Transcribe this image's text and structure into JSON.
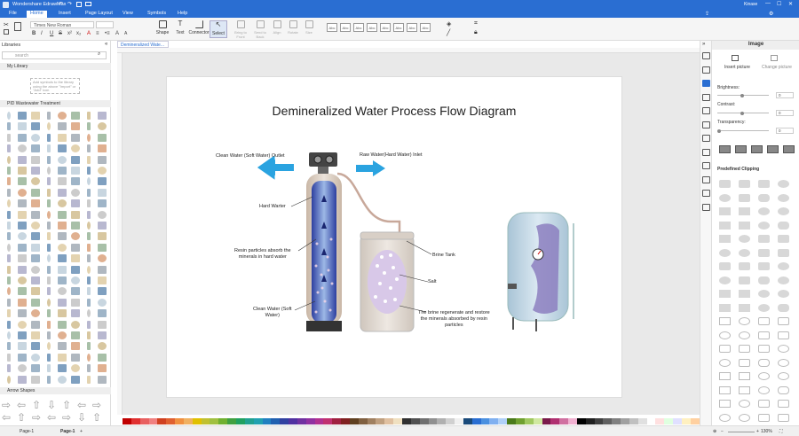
{
  "app": {
    "title": "Wondershare EdrawMax",
    "window_controls": [
      "—",
      "☐",
      "✕"
    ],
    "user": "Kinase"
  },
  "menu": {
    "items": [
      "File",
      "Home",
      "Insert",
      "Page Layout",
      "View",
      "Symbols",
      "Help"
    ],
    "active": "Home"
  },
  "ribbon": {
    "font": "Times New Roman",
    "size": "",
    "format": [
      "B",
      "I",
      "U",
      "S",
      "x²",
      "x₂",
      "A",
      "≡",
      "•≡",
      "A",
      "A"
    ],
    "tools": [
      {
        "label": "Shape"
      },
      {
        "label": "Text"
      },
      {
        "label": "Connector"
      },
      {
        "label": "Select"
      },
      {
        "label": "Bring to Front"
      },
      {
        "label": "Send to Back"
      },
      {
        "label": "Align"
      },
      {
        "label": "Rotate"
      },
      {
        "label": "Size"
      }
    ],
    "styles": [
      "Abc",
      "Abc",
      "Abc",
      "Abc",
      "Abc",
      "Abc",
      "Abc",
      "Abc"
    ]
  },
  "sidebar": {
    "title": "Libraries",
    "search_placeholder": "search",
    "my_library": "My Library",
    "hint": "Add symbols to the library using the above \"Import\" or \"Add\" icon",
    "pid_section": "PID Wastewater Treatment",
    "arrow_section": "Arrow Shapes"
  },
  "document": {
    "tab": "Demineralized Wate...",
    "page_label": "Page-1",
    "page_tab": "Page-1",
    "zoom": "130%"
  },
  "diagram": {
    "title": "Demineralized Water Process Flow Diagram",
    "labels": {
      "outlet": "Clean Water (Soft Water) Outlet",
      "inlet": "Raw Water(Hard Water) Inlet",
      "hard": "Hard Warter",
      "resin": "Resin particles absorb the\nminerals in hard water",
      "clean": "Clean Water (Soft\nWater)",
      "brine": "Brine Tank",
      "salt": "Salt",
      "regen": "The brine regenerate and restore\nthe minerals absorbed by resin\nparticles"
    }
  },
  "rpanel": {
    "title": "Image",
    "insert": "Insert picture",
    "change": "Change picture",
    "brightness": "Brightness:",
    "contrast": "Contrast:",
    "transparency": "Transparency:",
    "value": "0",
    "clipping": "Predefined Clipping"
  },
  "colors": {
    "brand": "#2a6ed2",
    "arrow": "#2aa3e0",
    "column": "#9db8e6",
    "resin": "#ece0ee",
    "tank": "#e6dfd8",
    "vessel": "#c8dbe8"
  }
}
